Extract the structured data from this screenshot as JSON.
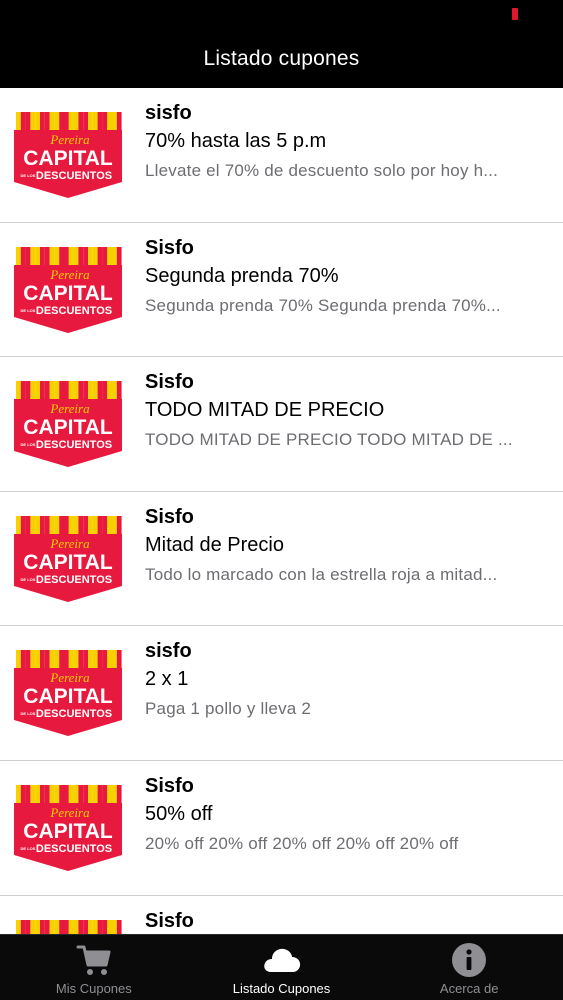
{
  "header": {
    "title": "Listado cupones"
  },
  "logo": {
    "line1": "Pereira",
    "line2": "CAPITAL",
    "line3_small": "DE LOS",
    "line3": "DESCUENTOS",
    "colors": {
      "red": "#e8193f",
      "yellow": "#f7d000",
      "white": "#ffffff"
    }
  },
  "coupons": [
    {
      "store": "sisfo",
      "title": "70% hasta las 5 p.m",
      "description": "Llevate el 70% de descuento solo por hoy h..."
    },
    {
      "store": "Sisfo",
      "title": "Segunda prenda 70%",
      "description": "Segunda prenda 70% Segunda prenda 70%..."
    },
    {
      "store": "Sisfo",
      "title": "TODO MITAD DE PRECIO",
      "description": "TODO MITAD DE PRECIO TODO MITAD DE ..."
    },
    {
      "store": "Sisfo",
      "title": "Mitad de Precio",
      "description": "Todo lo marcado con la estrella roja a mitad..."
    },
    {
      "store": "sisfo",
      "title": "2 x 1",
      "description": "Paga 1 pollo y lleva 2"
    },
    {
      "store": "Sisfo",
      "title": "50% off",
      "description": "20% off 20% off 20% off 20% off 20% off"
    },
    {
      "store": "Sisfo",
      "title": "",
      "description": ""
    }
  ],
  "tabs": [
    {
      "label": "Mis Cupones",
      "icon": "cart-icon",
      "active": false
    },
    {
      "label": "Listado Cupones",
      "icon": "cloud-icon",
      "active": true
    },
    {
      "label": "Acerca de",
      "icon": "info-icon",
      "active": false
    }
  ]
}
